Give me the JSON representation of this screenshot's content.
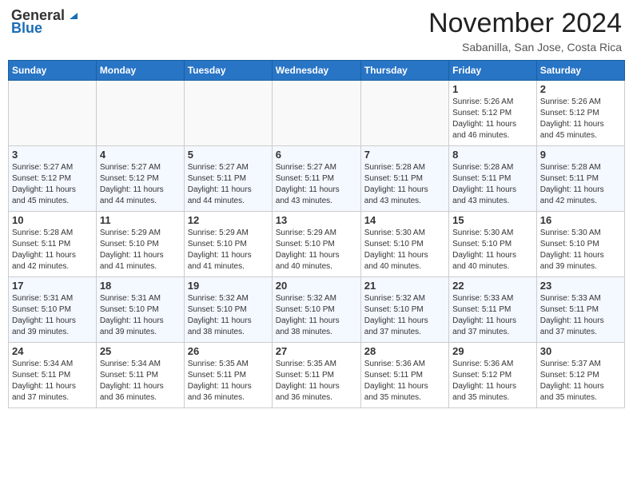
{
  "header": {
    "logo_general": "General",
    "logo_blue": "Blue",
    "month_title": "November 2024",
    "location": "Sabanilla, San Jose, Costa Rica"
  },
  "weekdays": [
    "Sunday",
    "Monday",
    "Tuesday",
    "Wednesday",
    "Thursday",
    "Friday",
    "Saturday"
  ],
  "weeks": [
    [
      {
        "day": "",
        "info": ""
      },
      {
        "day": "",
        "info": ""
      },
      {
        "day": "",
        "info": ""
      },
      {
        "day": "",
        "info": ""
      },
      {
        "day": "",
        "info": ""
      },
      {
        "day": "1",
        "info": "Sunrise: 5:26 AM\nSunset: 5:12 PM\nDaylight: 11 hours\nand 46 minutes."
      },
      {
        "day": "2",
        "info": "Sunrise: 5:26 AM\nSunset: 5:12 PM\nDaylight: 11 hours\nand 45 minutes."
      }
    ],
    [
      {
        "day": "3",
        "info": "Sunrise: 5:27 AM\nSunset: 5:12 PM\nDaylight: 11 hours\nand 45 minutes."
      },
      {
        "day": "4",
        "info": "Sunrise: 5:27 AM\nSunset: 5:12 PM\nDaylight: 11 hours\nand 44 minutes."
      },
      {
        "day": "5",
        "info": "Sunrise: 5:27 AM\nSunset: 5:11 PM\nDaylight: 11 hours\nand 44 minutes."
      },
      {
        "day": "6",
        "info": "Sunrise: 5:27 AM\nSunset: 5:11 PM\nDaylight: 11 hours\nand 43 minutes."
      },
      {
        "day": "7",
        "info": "Sunrise: 5:28 AM\nSunset: 5:11 PM\nDaylight: 11 hours\nand 43 minutes."
      },
      {
        "day": "8",
        "info": "Sunrise: 5:28 AM\nSunset: 5:11 PM\nDaylight: 11 hours\nand 43 minutes."
      },
      {
        "day": "9",
        "info": "Sunrise: 5:28 AM\nSunset: 5:11 PM\nDaylight: 11 hours\nand 42 minutes."
      }
    ],
    [
      {
        "day": "10",
        "info": "Sunrise: 5:28 AM\nSunset: 5:11 PM\nDaylight: 11 hours\nand 42 minutes."
      },
      {
        "day": "11",
        "info": "Sunrise: 5:29 AM\nSunset: 5:10 PM\nDaylight: 11 hours\nand 41 minutes."
      },
      {
        "day": "12",
        "info": "Sunrise: 5:29 AM\nSunset: 5:10 PM\nDaylight: 11 hours\nand 41 minutes."
      },
      {
        "day": "13",
        "info": "Sunrise: 5:29 AM\nSunset: 5:10 PM\nDaylight: 11 hours\nand 40 minutes."
      },
      {
        "day": "14",
        "info": "Sunrise: 5:30 AM\nSunset: 5:10 PM\nDaylight: 11 hours\nand 40 minutes."
      },
      {
        "day": "15",
        "info": "Sunrise: 5:30 AM\nSunset: 5:10 PM\nDaylight: 11 hours\nand 40 minutes."
      },
      {
        "day": "16",
        "info": "Sunrise: 5:30 AM\nSunset: 5:10 PM\nDaylight: 11 hours\nand 39 minutes."
      }
    ],
    [
      {
        "day": "17",
        "info": "Sunrise: 5:31 AM\nSunset: 5:10 PM\nDaylight: 11 hours\nand 39 minutes."
      },
      {
        "day": "18",
        "info": "Sunrise: 5:31 AM\nSunset: 5:10 PM\nDaylight: 11 hours\nand 39 minutes."
      },
      {
        "day": "19",
        "info": "Sunrise: 5:32 AM\nSunset: 5:10 PM\nDaylight: 11 hours\nand 38 minutes."
      },
      {
        "day": "20",
        "info": "Sunrise: 5:32 AM\nSunset: 5:10 PM\nDaylight: 11 hours\nand 38 minutes."
      },
      {
        "day": "21",
        "info": "Sunrise: 5:32 AM\nSunset: 5:10 PM\nDaylight: 11 hours\nand 37 minutes."
      },
      {
        "day": "22",
        "info": "Sunrise: 5:33 AM\nSunset: 5:11 PM\nDaylight: 11 hours\nand 37 minutes."
      },
      {
        "day": "23",
        "info": "Sunrise: 5:33 AM\nSunset: 5:11 PM\nDaylight: 11 hours\nand 37 minutes."
      }
    ],
    [
      {
        "day": "24",
        "info": "Sunrise: 5:34 AM\nSunset: 5:11 PM\nDaylight: 11 hours\nand 37 minutes."
      },
      {
        "day": "25",
        "info": "Sunrise: 5:34 AM\nSunset: 5:11 PM\nDaylight: 11 hours\nand 36 minutes."
      },
      {
        "day": "26",
        "info": "Sunrise: 5:35 AM\nSunset: 5:11 PM\nDaylight: 11 hours\nand 36 minutes."
      },
      {
        "day": "27",
        "info": "Sunrise: 5:35 AM\nSunset: 5:11 PM\nDaylight: 11 hours\nand 36 minutes."
      },
      {
        "day": "28",
        "info": "Sunrise: 5:36 AM\nSunset: 5:11 PM\nDaylight: 11 hours\nand 35 minutes."
      },
      {
        "day": "29",
        "info": "Sunrise: 5:36 AM\nSunset: 5:12 PM\nDaylight: 11 hours\nand 35 minutes."
      },
      {
        "day": "30",
        "info": "Sunrise: 5:37 AM\nSunset: 5:12 PM\nDaylight: 11 hours\nand 35 minutes."
      }
    ]
  ]
}
